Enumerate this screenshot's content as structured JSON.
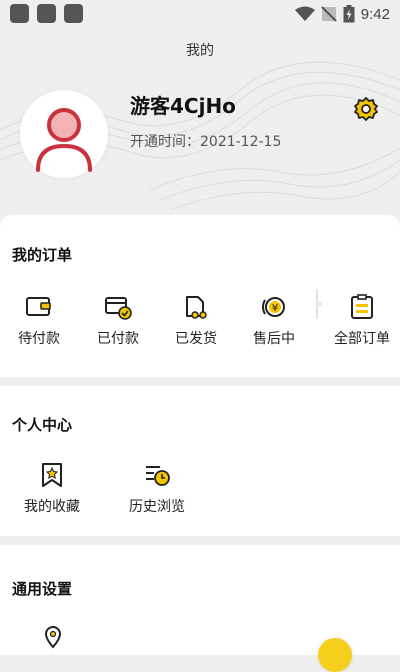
{
  "status_bar": {
    "time": "9:42",
    "icons": [
      "wifi-icon",
      "signal-off-icon",
      "battery-icon"
    ]
  },
  "header": {
    "title": "我的"
  },
  "profile": {
    "username": "游客4CjHo",
    "joined": "开通时间：2021-12-15"
  },
  "orders": {
    "title": "我的订单",
    "items": [
      {
        "label": "待付款",
        "icon": "wallet-icon"
      },
      {
        "label": "已付款",
        "icon": "card-paid-icon"
      },
      {
        "label": "已发货",
        "icon": "shipped-icon"
      },
      {
        "label": "售后中",
        "icon": "after-sale-icon"
      },
      {
        "label": "全部订单",
        "icon": "all-orders-icon"
      }
    ]
  },
  "personal": {
    "title": "个人中心",
    "items": [
      {
        "label": "我的收藏",
        "icon": "favorites-icon"
      },
      {
        "label": "历史浏览",
        "icon": "history-icon"
      }
    ]
  },
  "settings": {
    "title": "通用设置",
    "items": [
      {
        "icon": "location-icon"
      }
    ]
  },
  "colors": {
    "accent": "#f5c400",
    "avatar_red": "#c8323c",
    "avatar_pink": "#f6b3b5",
    "background": "#efefef"
  }
}
